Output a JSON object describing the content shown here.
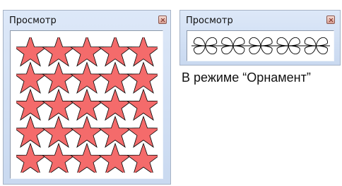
{
  "preview_window_1": {
    "title": "Просмотр"
  },
  "preview_window_2": {
    "title": "Просмотр"
  },
  "caption": "В режиме “Орнамент”",
  "colors": {
    "star_fill": "#f46b6b",
    "star_stroke": "#000000",
    "panel_bg": "#d4e1f5",
    "canvas_bg": "#ffffff"
  },
  "icons": {
    "close": "close-icon",
    "star": "star-icon",
    "ornament": "butterfly-motif-icon"
  },
  "stars_grid": {
    "rows": 5,
    "columns": 5
  },
  "ornament": {
    "motif_count": 5
  }
}
